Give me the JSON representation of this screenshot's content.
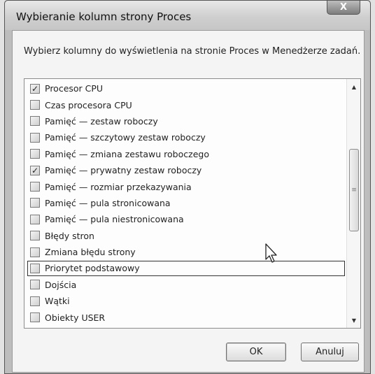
{
  "window": {
    "title": "Wybieranie kolumn strony Proces",
    "close_label": "X"
  },
  "instruction": "Wybierz kolumny do wyświetlenia na stronie Proces w Menedżerze zadań.",
  "columns": [
    {
      "label": "Procesor CPU",
      "checked": true
    },
    {
      "label": "Czas procesora CPU",
      "checked": false
    },
    {
      "label": "Pamięć — zestaw roboczy",
      "checked": false
    },
    {
      "label": "Pamięć — szczytowy zestaw roboczy",
      "checked": false
    },
    {
      "label": "Pamięć — zmiana zestawu roboczego",
      "checked": false
    },
    {
      "label": "Pamięć — prywatny zestaw roboczy",
      "checked": true
    },
    {
      "label": "Pamięć — rozmiar przekazywania",
      "checked": false
    },
    {
      "label": "Pamięć — pula stronicowana",
      "checked": false
    },
    {
      "label": "Pamięć — pula niestronicowana",
      "checked": false
    },
    {
      "label": "Błędy stron",
      "checked": false
    },
    {
      "label": "Zmiana błędu strony",
      "checked": false
    },
    {
      "label": "Priorytet podstawowy",
      "checked": false,
      "focused": true
    },
    {
      "label": "Dojścia",
      "checked": false
    },
    {
      "label": "Wątki",
      "checked": false
    },
    {
      "label": "Obiekty USER",
      "checked": false
    }
  ],
  "buttons": {
    "ok": "OK",
    "cancel": "Anuluj"
  },
  "icons": {
    "check": "✓",
    "scroll_up": "▲",
    "scroll_down": "▼",
    "thumb_grip": "≡"
  }
}
